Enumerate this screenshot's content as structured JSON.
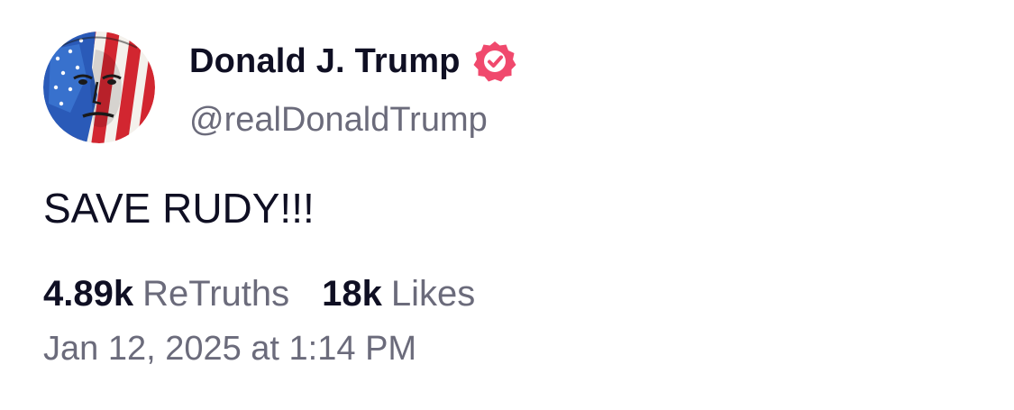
{
  "author": {
    "display_name": "Donald J. Trump",
    "handle": "@realDonaldTrump",
    "verified": true,
    "verified_icon": "verified-badge-icon",
    "verified_color": "#f0496d",
    "avatar_icon": "user-avatar"
  },
  "post": {
    "text": "SAVE RUDY!!!"
  },
  "stats": {
    "retruths_count": "4.89k",
    "retruths_label": "ReTruths",
    "likes_count": "18k",
    "likes_label": "Likes"
  },
  "timestamp": "Jan 12, 2025 at 1:14 PM",
  "colors": {
    "primary_text": "#0f0f23",
    "secondary_text": "#6b6b7b",
    "background": "#ffffff"
  }
}
